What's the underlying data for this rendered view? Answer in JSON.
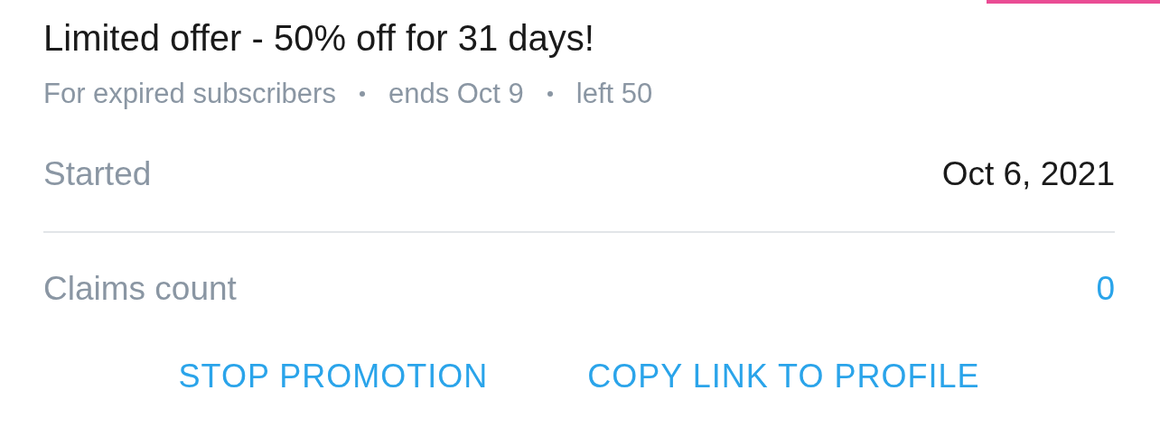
{
  "offer": {
    "title": "Limited offer - 50% off for 31 days!",
    "meta": [
      "For expired subscribers",
      "ends Oct 9",
      "left 50"
    ]
  },
  "details": [
    {
      "label": "Started",
      "value": "Oct 6, 2021",
      "kind": "plain"
    },
    {
      "label": "Claims count",
      "value": "0",
      "kind": "link"
    }
  ],
  "buttons": [
    "STOP PROMOTION",
    "COPY LINK TO PROFILE"
  ]
}
